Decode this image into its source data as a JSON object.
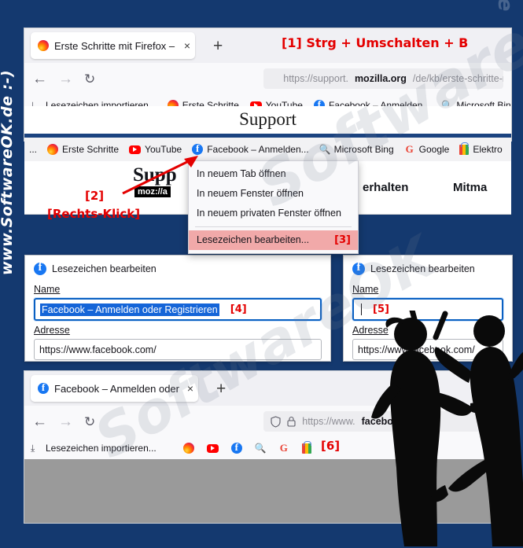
{
  "watermarks": {
    "left": "www.SoftwareOK.de :-)",
    "right": "OK.de",
    "diagonal_1": "SoftwareOK",
    "diagonal_2": "SoftwareOK"
  },
  "annotations": {
    "step1": "[1] Strg + Umschalten + B",
    "step2": "[2]",
    "step2b": "[Rechts-Klick]",
    "step3": "[3]",
    "step4": "[4]",
    "step5": "[5]",
    "step6": "[6]"
  },
  "window_top": {
    "tab": {
      "title": "Erste Schritte mit Firefox – Überb",
      "close": "×",
      "favicon": "firefox-icon"
    },
    "newtab_label": "+",
    "nav": {
      "back": "←",
      "forward": "→",
      "reload": "↻"
    },
    "urlbar": {
      "shield": "shield-icon",
      "lock": "lock-icon",
      "prefix": "https://support.",
      "host": "mozilla.org",
      "suffix": "/de/kb/erste-schritte-mit-fir"
    },
    "bookmarks": [
      {
        "label": "Lesezeichen importieren...",
        "icon": "import-icon"
      },
      {
        "label": "Erste Schritte",
        "icon": "firefox-icon"
      },
      {
        "label": "YouTube",
        "icon": "youtube-icon"
      },
      {
        "label": "Facebook – Anmelden...",
        "icon": "facebook-icon"
      },
      {
        "label": "Microsoft Bing",
        "icon": "bing-icon"
      }
    ]
  },
  "page": {
    "site_title": "Support",
    "brand": "Supp",
    "moz_badge": "moz://a",
    "nav_links": [
      "erhalten",
      "Mitma"
    ]
  },
  "bookmarks_bar_2": [
    {
      "label": "...",
      "icon": "overflow-icon"
    },
    {
      "label": "Erste Schritte",
      "icon": "firefox-icon"
    },
    {
      "label": "YouTube",
      "icon": "youtube-icon"
    },
    {
      "label": "Facebook – Anmelden...",
      "icon": "facebook-icon"
    },
    {
      "label": "Microsoft Bing",
      "icon": "bing-icon"
    },
    {
      "label": "Google",
      "icon": "google-icon"
    },
    {
      "label": "Elektro",
      "icon": "shopping-bag-icon"
    }
  ],
  "context_menu": {
    "items": [
      {
        "label": "In neuem Tab öffnen",
        "accel": "T",
        "highlight": false
      },
      {
        "label": "In neuem Fenster öffnen",
        "accel": "F",
        "highlight": false
      },
      {
        "label": "In neuem privaten Fenster öffnen",
        "accel": "p",
        "highlight": false
      }
    ],
    "highlighted": {
      "label": "Lesezeichen bearbeiten...",
      "accel": "b",
      "tag": "[3]"
    }
  },
  "dialog_left": {
    "title": "Lesezeichen bearbeiten",
    "name_label": "Name",
    "name_value": "Facebook – Anmelden oder Registrieren",
    "address_label": "Adresse",
    "address_value": "https://www.facebook.com/",
    "tag": "[4]"
  },
  "dialog_right": {
    "title": "Lesezeichen bearbeiten",
    "name_label": "Name",
    "name_value": "",
    "address_label": "Adresse",
    "address_value": "https://www.facebook.com/",
    "tag": "[5]"
  },
  "window_bottom": {
    "tab": {
      "title": "Facebook – Anmelden oder Reg",
      "close": "×",
      "favicon": "facebook-icon"
    },
    "newtab_label": "+",
    "nav": {
      "back": "←",
      "forward": "→",
      "reload": "↻"
    },
    "urlbar": {
      "shield": "shield-icon",
      "lock": "lock-icon",
      "prefix": "https://www.",
      "host": "facebook.com",
      "suffix": ""
    },
    "bookmarks": [
      {
        "label": "Lesezeichen importieren...",
        "icon": "import-icon"
      },
      {
        "label": "",
        "icon": "firefox-icon"
      },
      {
        "label": "",
        "icon": "youtube-icon"
      },
      {
        "label": "",
        "icon": "facebook-icon"
      },
      {
        "label": "",
        "icon": "bing-icon"
      },
      {
        "label": "",
        "icon": "google-icon"
      },
      {
        "label": "",
        "icon": "shopping-bag-icon"
      }
    ]
  },
  "colors": {
    "background": "#14396f",
    "accent_red": "#e40000",
    "mozilla_blue": "#1b4380",
    "highlight_pink": "#f1a9a9",
    "selection_blue": "#1565d8"
  }
}
